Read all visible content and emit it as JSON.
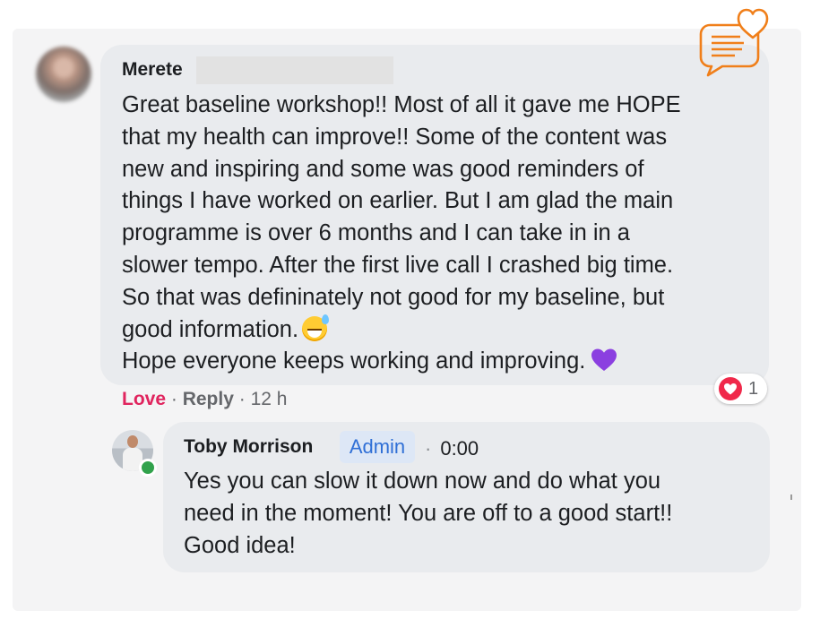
{
  "comment": {
    "author": "Merete",
    "lines": [
      "Great baseline workshop!! Most of all it gave me HOPE",
      "that my health can improve!! Some of the content was",
      "new and inspiring and some was good reminders of",
      "things I have worked on earlier. But I am glad the main",
      "programme is over 6 months and I can take in in a",
      "slower tempo. After the first live call I crashed big time.",
      "So that was defininately not good for my baseline, but",
      "good information.",
      "Hope everyone keeps working and improving."
    ],
    "actions": {
      "love": "Love",
      "separator": "·",
      "reply": "Reply",
      "time": "12 h"
    },
    "reaction_count": "1",
    "colors": {
      "love": "#e0245e",
      "reaction": "#f0284a",
      "purple_heart": "#8b3fe0"
    }
  },
  "reply": {
    "author": "Toby Morrison",
    "badge": "Admin",
    "separator": "·",
    "time": "0:00",
    "lines": [
      "Yes you can slow it down now and do what you",
      "need in the moment! You are off to a good start!!",
      "Good idea!"
    ],
    "online": true
  },
  "icons": {
    "emoji": "grinning-sweat-emoji-icon",
    "heart": "purple-heart-icon",
    "reaction": "love-reaction-icon",
    "logo": "chat-heart-logo-icon",
    "logo_color": "#f07f1a"
  }
}
